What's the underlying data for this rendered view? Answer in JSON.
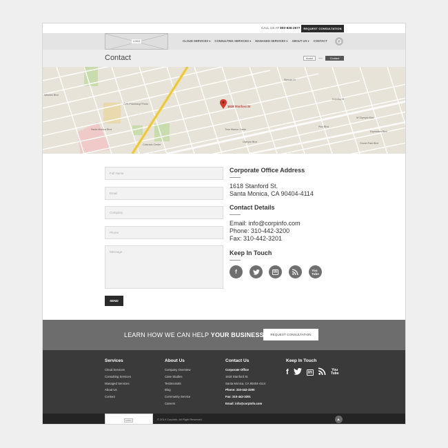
{
  "topbar": {
    "call_label": "CALL US AT",
    "phone": "800-836-2677",
    "request_label": "REQUEST CONSULTATION"
  },
  "nav": {
    "logo": "LOGO",
    "items": [
      {
        "label": "CLOUD SERVICES ▾"
      },
      {
        "label": "CONSULTING SERVICES ▾"
      },
      {
        "label": "MANAGED SERVICES ▾"
      },
      {
        "label": "ABOUT US ▾"
      },
      {
        "label": "CONTACT"
      }
    ]
  },
  "page": {
    "title": "Contact",
    "breadcrumb_home": "Home",
    "breadcrumb_current": "Contact"
  },
  "map": {
    "pin_label": "1618 Stanford St",
    "places": [
      "CVS Pharmacy/ Photo",
      "Olympic Blvd",
      "Colorado Center",
      "Time Warner Cable",
      "Ocean Park Blvd",
      "Santa Monica Blvd",
      "Stewart St",
      "Dorothy St",
      "W Olympic Blvd",
      "Pico Blvd",
      "Exposition Blvd",
      "Wilshire Blvd"
    ]
  },
  "form": {
    "full_name_placeholder": "Full Name",
    "email_placeholder": "Email",
    "company_placeholder": "Company",
    "phone_placeholder": "Phone",
    "message_placeholder": "Message",
    "send_label": "SEND"
  },
  "contact": {
    "office_heading": "Corporate Office Address",
    "address_line1": "1618 Stanford St.",
    "address_line2": "Santa Monica, CA 90404-4114",
    "details_heading": "Contact Details",
    "email": "Email: info@corpinfo.com",
    "phone": "Phone: 310-442-3200",
    "fax": "Fax: 310-442-3201",
    "keep_heading": "Keep In Touch",
    "social_icons": [
      "facebook-icon",
      "twitter-icon",
      "linkedin-icon",
      "rss-icon",
      "youtube-icon"
    ]
  },
  "cta": {
    "text_plain": "LEARN HOW WE CAN HELP ",
    "text_bold": "YOUR BUSINESS",
    "button_label": "REQUEST CONSULTATION"
  },
  "footer": {
    "services": {
      "heading": "Services",
      "items": [
        "Cloud Services",
        "Consulting Services",
        "Managed Services",
        "About Us",
        "Contact"
      ]
    },
    "about": {
      "heading": "About Us",
      "items": [
        "Company Overview",
        "Case Studies",
        "Testimonials",
        "Blog",
        "Community Service",
        "Careers"
      ]
    },
    "contact": {
      "heading": "Contact Us",
      "office": "Corporate Office",
      "line1": "1618 Stanford St.",
      "line2": "Santa Monica, CA 90404-4114",
      "phone": "Phone: 310-442-3200",
      "fax": "Fax: 310-442-3201",
      "email": "Email: info@corpinfo.com"
    },
    "keep": {
      "heading": "Keep In Touch"
    },
    "logo": "LOGO",
    "copyright": "© 2014 CorpInfo. All Right Reserved."
  }
}
